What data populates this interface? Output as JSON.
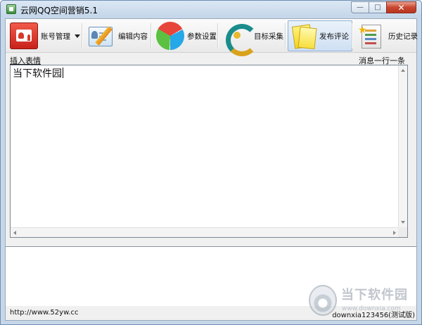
{
  "window": {
    "title": "云网QQ空间营销5.1",
    "controls": {
      "minimize": "—",
      "maximize": "□",
      "close": "✕"
    }
  },
  "toolbar": {
    "items": [
      {
        "label": "账号管理",
        "icon": "account-card-icon",
        "has_dropdown": true
      },
      {
        "label": "编辑内容",
        "icon": "edit-content-icon"
      },
      {
        "label": "参数设置",
        "icon": "pie-chart-icon"
      },
      {
        "label": "目标采集",
        "icon": "refresh-target-icon"
      },
      {
        "label": "发布评论",
        "icon": "sticky-notes-icon",
        "pressed": true
      },
      {
        "label": "历史记录",
        "icon": "history-list-icon"
      }
    ]
  },
  "editor": {
    "insert_emoji_link": "插入表情",
    "hint": "消息一行一条",
    "content": "当下软件园"
  },
  "status": {
    "left": "http://www.52yw.cc",
    "right": "downxia123456(测试版)"
  },
  "watermark": {
    "title": "当下软件园",
    "url": "www.downxia.com"
  },
  "colors": {
    "title_bar": "#c6d7ea",
    "close_button": "#c9462f",
    "pressed_button": "#cfe0f3"
  }
}
